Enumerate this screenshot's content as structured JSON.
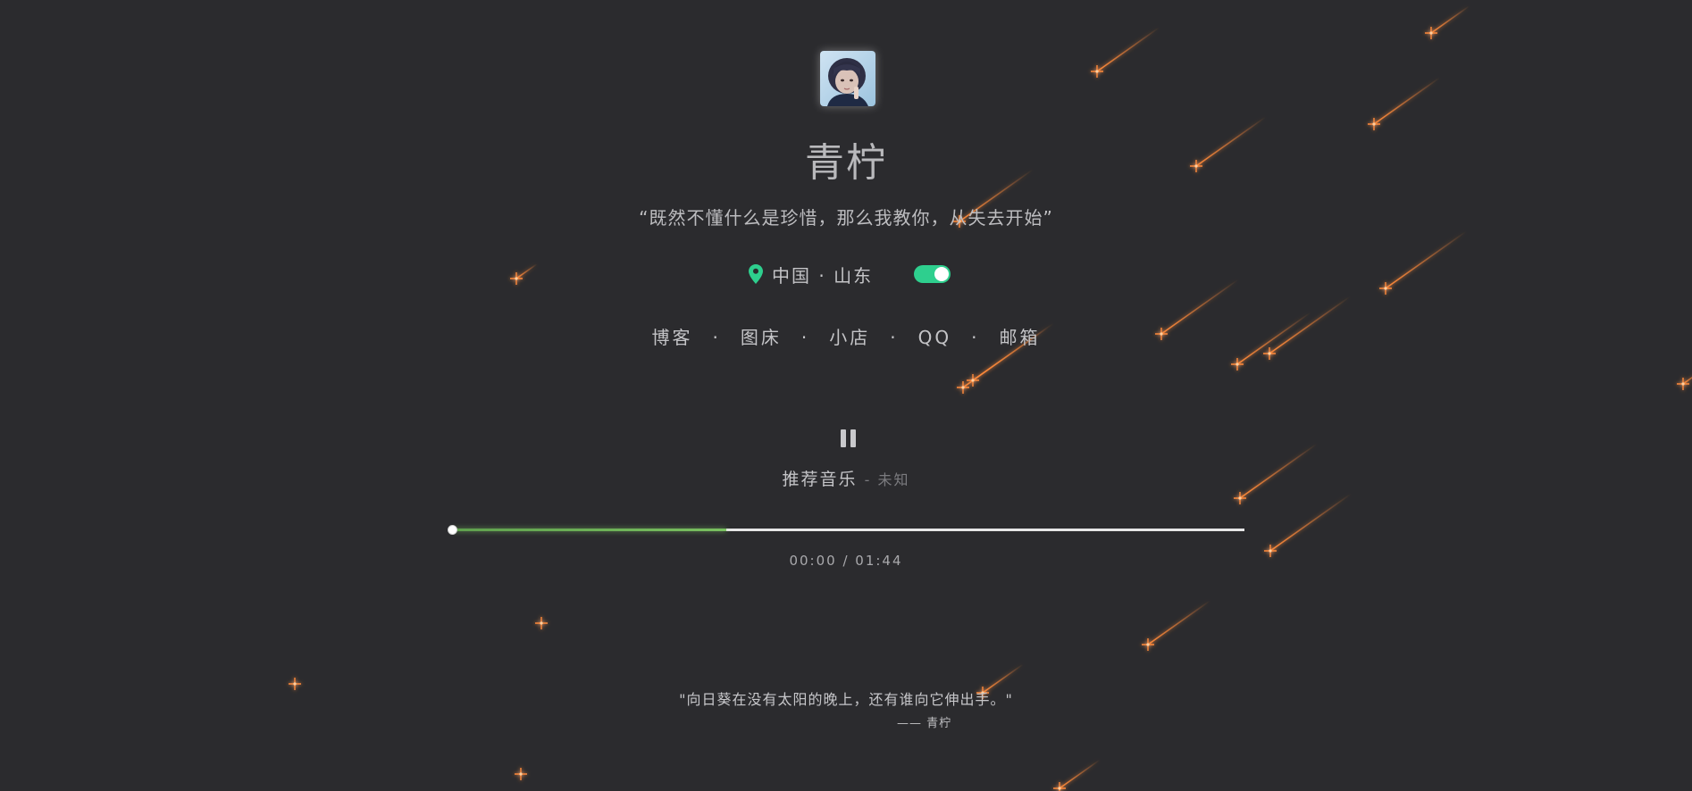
{
  "profile": {
    "name": "青柠",
    "motto": "“既然不懂什么是珍惜，那么我教你，从失去开始”",
    "location": "中国 · 山东",
    "avatar_alt": "avatar"
  },
  "theme_toggle": {
    "on": true,
    "accent": "#2ecf8e"
  },
  "links": [
    {
      "label": "博客"
    },
    {
      "label": "图床"
    },
    {
      "label": "小店"
    },
    {
      "label": "QQ"
    },
    {
      "label": "邮箱"
    }
  ],
  "link_separator": "·",
  "player": {
    "state_icon": "pause-icon",
    "track_title": "推荐音乐",
    "track_artist": "- 未知",
    "time": "00:00 / 01:44",
    "played_fraction": 0.0,
    "buffered_fraction": 0.345,
    "accent": "#79c060"
  },
  "quote": {
    "text": "\"向日葵在没有太阳的晚上，还有谁向它伸出手。\"",
    "author": "—— 青柠"
  },
  "colors": {
    "background": "#2b2b2e",
    "meteor": "#ff7a2f",
    "location_pin": "#2ecf8e"
  }
}
